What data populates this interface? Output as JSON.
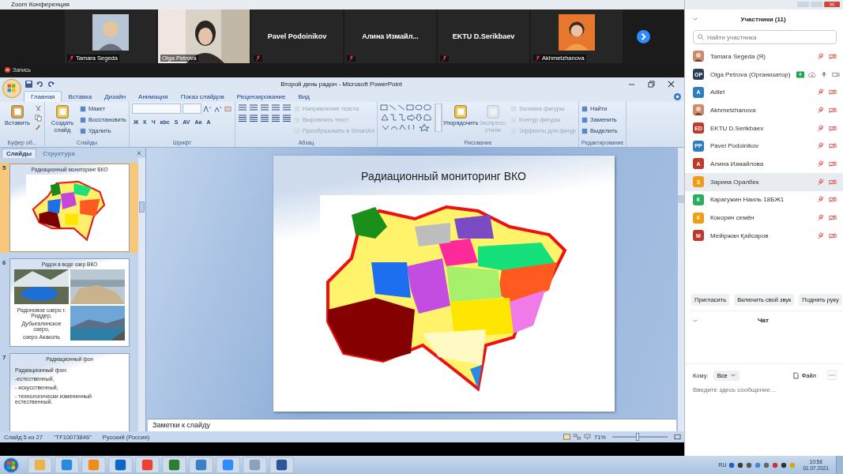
{
  "zoom_window": {
    "title": "Zoom Конференция"
  },
  "video_tiles": [
    {
      "name": "Tamara Segeda",
      "muted": true,
      "selected": false
    },
    {
      "kind": "video",
      "name": "Olga Petrova",
      "muted": false,
      "selected": true
    },
    {
      "kind": "name",
      "name": "Pavel Podoinikov",
      "muted": true,
      "selected": false
    },
    {
      "kind": "name",
      "name": "Алина  Измайл...",
      "muted": true,
      "selected": false
    },
    {
      "kind": "name",
      "name": "EKTU D.Serikbaev",
      "muted": true,
      "selected": false
    },
    {
      "name": "Akhmetzhanova",
      "muted": true,
      "selected": false
    }
  ],
  "recording": {
    "label": "Запись"
  },
  "powerpoint": {
    "title": "Второй день радон - Microsoft PowerPoint",
    "tabs": [
      {
        "label": "Главная",
        "selected": true
      },
      {
        "label": "Вставка",
        "selected": false
      },
      {
        "label": "Дизайн",
        "selected": false
      },
      {
        "label": "Анимация",
        "selected": false
      },
      {
        "label": "Показ слайдов",
        "selected": false
      },
      {
        "label": "Рецензирование",
        "selected": false
      },
      {
        "label": "Вид",
        "selected": false
      }
    ],
    "ribbon": [
      {
        "kind": "clipboard",
        "label": "Буфер об...",
        "big": [
          {
            "label": "Вставить",
            "disabled": false
          }
        ]
      },
      {
        "kind": "slides",
        "label": "Слайды",
        "big": [
          {
            "label": "Создать слайд",
            "disabled": false
          }
        ],
        "items": [
          {
            "label": "Макет",
            "disabled": false
          },
          {
            "label": "Восстановить",
            "disabled": false
          },
          {
            "label": "Удалить",
            "disabled": false
          }
        ]
      },
      {
        "kind": "font",
        "label": "Шрифт",
        "buttons": [
          "Ж",
          "К",
          "Ч",
          "abc",
          "S",
          "AV",
          "Aa",
          "A"
        ]
      },
      {
        "kind": "paragraph",
        "label": "Абзац",
        "items": [
          {
            "label": "Направление текста",
            "disabled": true
          },
          {
            "label": "Выровнять текст",
            "disabled": true
          },
          {
            "label": "Преобразовать в SmartArt",
            "disabled": true
          }
        ]
      },
      {
        "kind": "drawing",
        "label": "Рисование",
        "big": [
          {
            "label": "Упорядочить",
            "disabled": false
          },
          {
            "label": "Экспресс-стили",
            "disabled": true
          }
        ],
        "items": [
          {
            "label": "Заливка фигуры",
            "disabled": true
          },
          {
            "label": "Контур фигуры",
            "disabled": true
          },
          {
            "label": "Эффекты для фигур",
            "disabled": true
          }
        ]
      },
      {
        "kind": "editing",
        "label": "Редактирование",
        "items": [
          {
            "label": "Найти",
            "disabled": false
          },
          {
            "label": "Заменить",
            "disabled": false
          },
          {
            "label": "Выделить",
            "disabled": false
          }
        ]
      }
    ],
    "pane_tabs": [
      {
        "label": "Слайды",
        "selected": true
      },
      {
        "label": "Структура",
        "selected": false
      }
    ],
    "thumbnails": [
      {
        "number": "5",
        "kind": "map",
        "selected": true,
        "title": "Радиационный мониторинг ВКО"
      },
      {
        "number": "6",
        "kind": "photos",
        "selected": false,
        "title": "Радон в воде озер ВКО",
        "lines": [
          "Радоновое озеро г. Риддер,",
          "Дубыгалинское озеро,",
          "озеро Акаколь"
        ]
      },
      {
        "number": "7",
        "kind": "text",
        "selected": false,
        "title": "Радиационный фон",
        "lines": [
          "Радиационный фон:",
          "-естественный,",
          "- искусственный,",
          "- технологически измененный естественный."
        ]
      }
    ],
    "slide": {
      "title": "Радиационный мониторинг ВКО"
    },
    "notes": {
      "placeholder": "Заметки к слайду"
    },
    "status_bar": {
      "slide": "Слайд 5 из 27",
      "theme": "\"TF10073846\"",
      "language": "Русский (Россия)",
      "zoom": "71%",
      "level": 0.45
    }
  },
  "participants": {
    "title": "Участники (11)",
    "search_placeholder": "Найти участника",
    "items": [
      {
        "name": "Tamara Segeda (Я)",
        "muted": true,
        "recording": false,
        "selected": false
      },
      {
        "name": "Olga Petrova (Организатор)",
        "kind": "initials",
        "initials": "OP",
        "color": "#2c3e56",
        "muted": false,
        "recording": true,
        "selected": false
      },
      {
        "name": "Adlet",
        "kind": "initials",
        "initials": "A",
        "color": "#2f7dc1",
        "muted": true,
        "recording": false,
        "selected": false
      },
      {
        "name": "Akhmetzhanova",
        "muted": true,
        "recording": false,
        "selected": false
      },
      {
        "name": "EKTU D.Serikbaev",
        "kind": "initials",
        "initials": "ED",
        "color": "#c0392b",
        "muted": true,
        "recording": false,
        "selected": false
      },
      {
        "name": "Pavel Podoinikov",
        "kind": "initials",
        "initials": "PP",
        "color": "#2f7dc1",
        "muted": true,
        "recording": false,
        "selected": false
      },
      {
        "name": "Алина Измайлова",
        "kind": "initials",
        "initials": "A",
        "color": "#c0392b",
        "muted": true,
        "recording": false,
        "selected": false
      },
      {
        "name": "Зарина Оралбек",
        "kind": "initials",
        "initials": "З",
        "color": "#f39c12",
        "muted": true,
        "recording": false,
        "selected": true
      },
      {
        "name": "Карагужин Наиль 18БЖ1",
        "kind": "initials",
        "initials": "К",
        "color": "#27ae60",
        "muted": true,
        "recording": false,
        "selected": false
      },
      {
        "name": "Кокорин семён",
        "kind": "initials",
        "initials": "К",
        "color": "#f39c12",
        "muted": true,
        "recording": false,
        "selected": false
      },
      {
        "name": "Мейіржан Қайсаров",
        "kind": "initials",
        "initials": "М",
        "color": "#c0392b",
        "muted": true,
        "recording": false,
        "selected": false
      }
    ],
    "buttons": [
      "Пригласить",
      "Включить свой звук",
      "Поднять руку"
    ]
  },
  "chat": {
    "title": "Чат",
    "to_label": "Кому:",
    "to_value": "Все",
    "file": "Файл",
    "placeholder": "Введите здесь сообщение..."
  },
  "taskbar": {
    "language": "RU",
    "time": "10:58",
    "date": "01.07.2021"
  }
}
